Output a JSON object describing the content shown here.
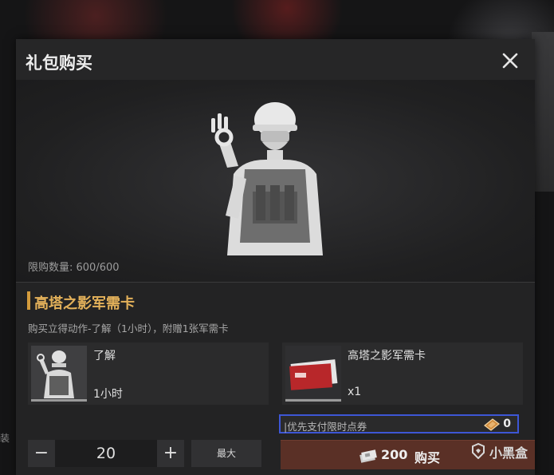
{
  "dialog": {
    "title": "礼包购买",
    "purchase_limit": "限购数量: 600/600"
  },
  "pack": {
    "title": "高塔之影军需卡",
    "description": "购买立得动作-了解（1小时），附赠1张军需卡"
  },
  "items": [
    {
      "name": "了解",
      "detail": "1小时",
      "icon": "emote-figure-thumbnail"
    },
    {
      "name": "高塔之影军需卡",
      "detail": "x1",
      "icon": "quartermaster-card-thumbnail"
    }
  ],
  "voucher": {
    "label": "|优先支付限时点券",
    "count": "0",
    "icon": "voucher-icon"
  },
  "quantity": {
    "minus": "−",
    "value": "20",
    "plus": "+",
    "max_label": "最大"
  },
  "buy": {
    "price": "200",
    "label": "购买",
    "icon": "currency-icon"
  },
  "watermark": {
    "text": "小黑盒"
  },
  "background": {
    "left_text": "装"
  },
  "colors": {
    "accent_gold": "#e3b15a",
    "buy_button": "#5a3026",
    "voucher_border": "#3d56d6"
  }
}
